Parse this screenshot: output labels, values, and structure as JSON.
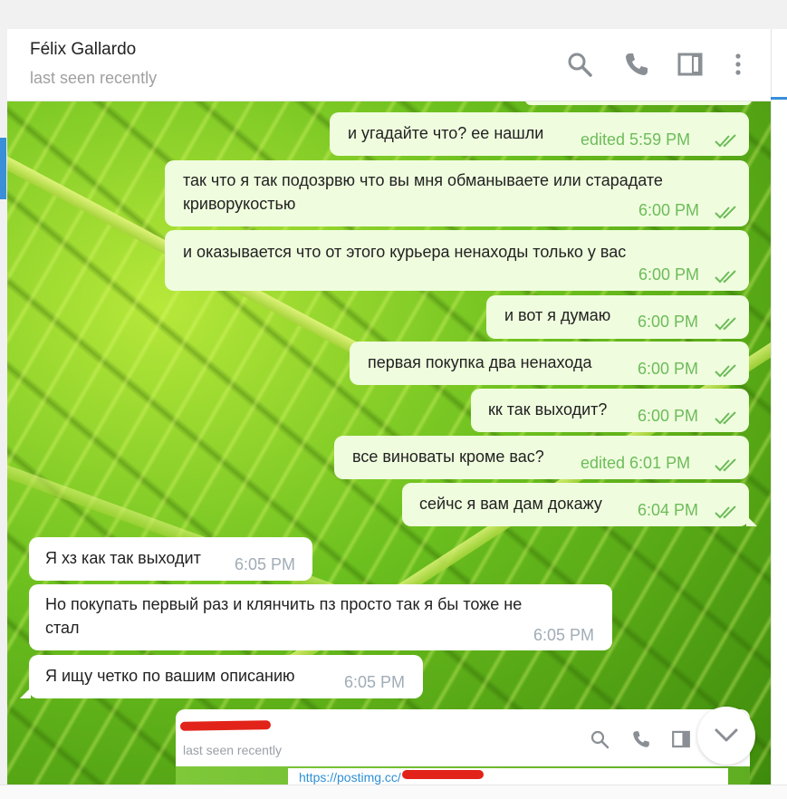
{
  "header": {
    "peer_name": "Félix Gallardo",
    "peer_status": "last seen recently",
    "icons": [
      "search-icon",
      "phone-icon",
      "sidebar-icon",
      "more-vertical-icon"
    ]
  },
  "colors": {
    "outgoing_bubble": "#effdde",
    "incoming_bubble": "#ffffff",
    "outgoing_time": "#6dbb5a",
    "incoming_time": "#a0acb6",
    "accent": "#3a8fd8"
  },
  "messages": [
    {
      "dir": "out",
      "lines": [
        "и угадайте что? ее нашли"
      ],
      "time": "edited 5:59 PM",
      "read": true
    },
    {
      "dir": "out",
      "lines": [
        "так что я так подозрвю что вы мня обманываете или старадате",
        "криворукостью"
      ],
      "time": "6:00 PM",
      "read": true
    },
    {
      "dir": "out",
      "lines": [
        "и оказывается что от этого курьера ненаходы только у вас"
      ],
      "time": "6:00 PM",
      "read": true
    },
    {
      "dir": "out",
      "lines": [
        "и вот я думаю"
      ],
      "time": "6:00 PM",
      "read": true
    },
    {
      "dir": "out",
      "lines": [
        "первая покупка два ненахода"
      ],
      "time": "6:00 PM",
      "read": true
    },
    {
      "dir": "out",
      "lines": [
        "кк так выходит?"
      ],
      "time": "6:00 PM",
      "read": true
    },
    {
      "dir": "out",
      "lines": [
        "все виноваты кроме вас?"
      ],
      "time": "edited 6:01 PM",
      "read": true
    },
    {
      "dir": "out",
      "lines": [
        "сейчс я вам дам докажу"
      ],
      "time": "6:04 PM",
      "read": true
    },
    {
      "dir": "in",
      "lines": [
        "Я хз как так выходит"
      ],
      "time": "6:05 PM"
    },
    {
      "dir": "in",
      "lines": [
        "Но покупать первый раз и клянчить пз просто так я бы тоже не",
        "стал"
      ],
      "time": "6:05 PM"
    },
    {
      "dir": "in",
      "lines": [
        "Я ищу четко по вашим описанию"
      ],
      "time": "6:05 PM"
    }
  ],
  "screenshot_preview": {
    "peer_status": "last seen recently",
    "link_text": "https://postimg.cc/"
  }
}
